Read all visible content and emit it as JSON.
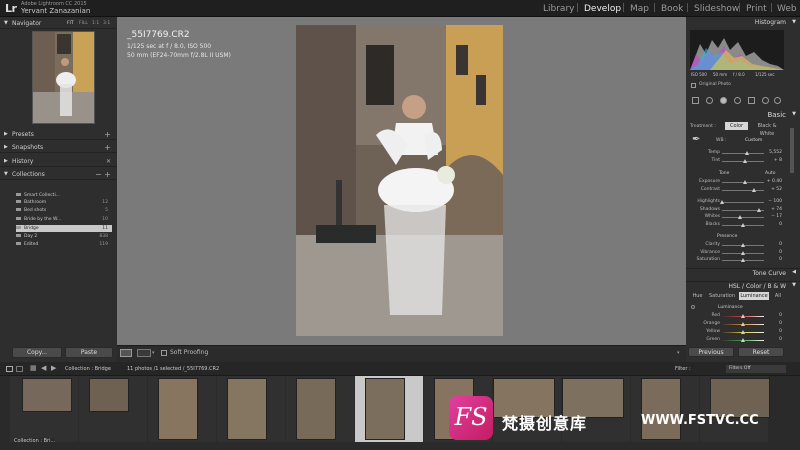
{
  "app": {
    "logo": "Lr",
    "name": "Adobe Lightroom CC 2015",
    "user": "Yervant Zanazanian"
  },
  "modules": [
    "Library",
    "Develop",
    "Map",
    "Book",
    "Slideshow",
    "Print",
    "Web"
  ],
  "active_module": "Develop",
  "left_panel": {
    "navigator": {
      "title": "Navigator",
      "zoom": "FIT",
      "zoom_opts": [
        "FILL",
        "1:1",
        "3:1"
      ]
    },
    "presets": "Presets",
    "snapshots": "Snapshots",
    "history": "History",
    "collections": {
      "title": "Collections",
      "items": [
        {
          "label": "Smart Collecti...",
          "count": ""
        },
        {
          "label": "Bathroom",
          "count": "12"
        },
        {
          "label": "Bed shots",
          "count": "5"
        },
        {
          "label": "Bride by the W...",
          "count": "10"
        },
        {
          "label": "Bridge",
          "count": "11"
        },
        {
          "label": "Day 2",
          "count": "838"
        },
        {
          "label": "Edited",
          "count": "119"
        }
      ],
      "selected": "Bridge"
    },
    "copy_label": "Copy...",
    "paste_label": "Paste"
  },
  "photo": {
    "filename": "_55I7769.CR2",
    "exposure": "1/125 sec at f / 8.0, ISO 500",
    "lens": "50 mm (EF24-70mm f/2.8L II USM)"
  },
  "toolbar": {
    "soft_proofing": "Soft Proofing"
  },
  "right_panel": {
    "histogram_title": "Histogram",
    "hist_info": [
      "ISO 500",
      "50 mm",
      "f / 8.0",
      "1/125 sec"
    ],
    "original_photo": "Original Photo",
    "basic_title": "Basic",
    "treatment_label": "Treatment :",
    "treatment_color": "Color",
    "treatment_bw": "Black & White",
    "wb_label": "WB :",
    "wb_value": "Custom",
    "tone_label": "Tone",
    "tone_auto": "Auto",
    "presence_label": "Presence",
    "sliders": [
      {
        "label": "Temp",
        "value": "5,552",
        "pos": 0.6
      },
      {
        "label": "Tint",
        "value": "+ 8",
        "pos": 0.55
      },
      {
        "label": "Exposure",
        "value": "+ 0.40",
        "pos": 0.55
      },
      {
        "label": "Contrast",
        "value": "+ 52",
        "pos": 0.75
      },
      {
        "label": "Highlights",
        "value": "− 100",
        "pos": 0.0
      },
      {
        "label": "Shadows",
        "value": "+ 74",
        "pos": 0.87
      },
      {
        "label": "Whites",
        "value": "− 17",
        "pos": 0.42
      },
      {
        "label": "Blacks",
        "value": "0",
        "pos": 0.5
      },
      {
        "label": "Clarity",
        "value": "0",
        "pos": 0.5
      },
      {
        "label": "Vibrance",
        "value": "0",
        "pos": 0.5
      },
      {
        "label": "Saturation",
        "value": "0",
        "pos": 0.5
      }
    ],
    "tone_curve_title": "Tone Curve",
    "hsl_title": "HSL  /  Color  /  B & W",
    "hsl_tabs": [
      "Hue",
      "Saturation",
      "Luminance",
      "All"
    ],
    "hsl_selected": "Luminance",
    "luminance_label": "Luminance",
    "hsl_sliders": [
      {
        "label": "Red",
        "value": "0"
      },
      {
        "label": "Orange",
        "value": "0"
      },
      {
        "label": "Yellow",
        "value": "0"
      },
      {
        "label": "Green",
        "value": "0"
      }
    ],
    "previous_label": "Previous",
    "reset_label": "Reset"
  },
  "filmstrip": {
    "collection": "Collection : Bridge",
    "count_info": "11 photos /1 selected /_55I7769.CR2",
    "filter_label": "Filter :",
    "filter_value": "Filters Off",
    "footer_status": "Collection : Bri..."
  },
  "watermark": {
    "logo_text": "FS",
    "chinese": "梵摄创意库",
    "url": "WWW.FSTVC.CC"
  },
  "colors": {
    "accent_pink": "#d22a7a",
    "panel_bg": "#2e2e2e",
    "selected_bg": "#c9c9c9"
  }
}
